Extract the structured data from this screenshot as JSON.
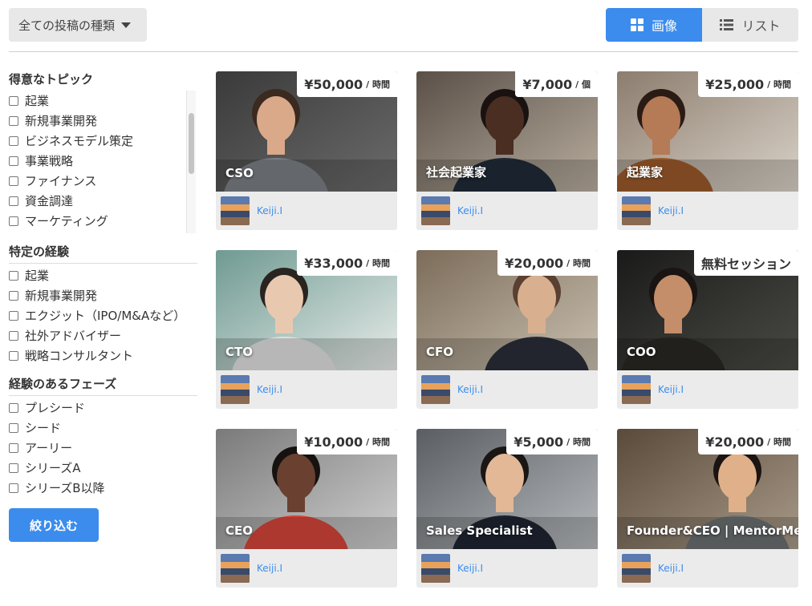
{
  "top_bar": {
    "post_type_dropdown": "全ての投稿の種類",
    "view_image_label": "画像",
    "view_list_label": "リスト"
  },
  "sidebar": {
    "topics_title": "得意なトピック",
    "topics": [
      "起業",
      "新規事業開発",
      "ビジネスモデル策定",
      "事業戦略",
      "ファイナンス",
      "資金調達",
      "マーケティング"
    ],
    "experience_title": "特定の経験",
    "experience": [
      "起業",
      "新規事業開発",
      "エクジット（IPO/M&Aなど）",
      "社外アドバイザー",
      "戦略コンサルタント"
    ],
    "phase_title": "経験のあるフェーズ",
    "phases": [
      "プレシード",
      "シード",
      "アーリー",
      "シリーズA",
      "シリーズB以降"
    ],
    "apply_label": "絞り込む"
  },
  "cards": [
    {
      "title": "CSO",
      "price": "¥50,000",
      "unit": "/ 時間",
      "author": "Keiji.I"
    },
    {
      "title": "社会起業家",
      "price": "¥7,000",
      "unit": "/ 個",
      "author": "Keiji.I"
    },
    {
      "title": "起業家",
      "price": "¥25,000",
      "unit": "/ 時間",
      "author": "Keiji.I"
    },
    {
      "title": "CTO",
      "price": "¥33,000",
      "unit": "/ 時間",
      "author": "Keiji.I"
    },
    {
      "title": "CFO",
      "price": "¥20,000",
      "unit": "/ 時間",
      "author": "Keiji.I"
    },
    {
      "title": "COO",
      "price": "無料セッション",
      "unit": "",
      "author": "Keiji.I"
    },
    {
      "title": "CEO",
      "price": "¥10,000",
      "unit": "/ 時間",
      "author": "Keiji.I"
    },
    {
      "title": "Sales Specialist",
      "price": "¥5,000",
      "unit": "/ 時間",
      "author": "Keiji.I"
    },
    {
      "title": "Founder&CEO | MentorMe",
      "price": "¥20,000",
      "unit": "/ 時間",
      "author": "Keiji.I"
    }
  ],
  "colors": {
    "accent": "#3b8ced",
    "toggle_inactive": "#e8e8e8"
  },
  "icons": {
    "dropdown": "caret-down-icon",
    "grid_view": "grid-icon",
    "list_view": "list-icon",
    "checkbox": "checkbox-icon"
  }
}
